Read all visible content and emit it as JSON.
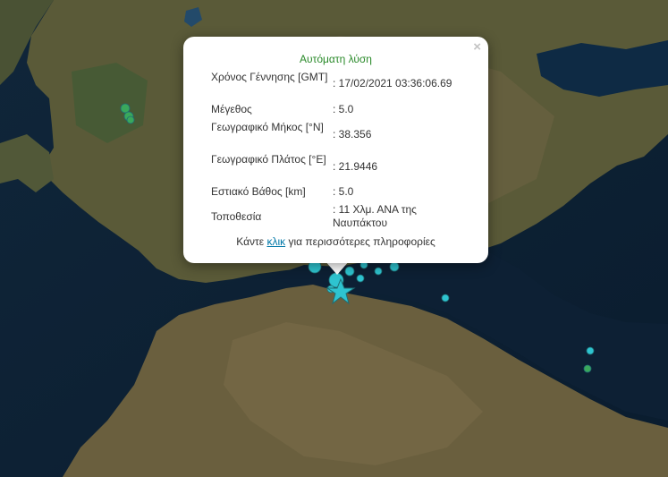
{
  "popup": {
    "title": "Αυτόματη λύση",
    "close_label": "×",
    "rows": [
      {
        "label": "Χρόνος Γέννησης [GMT]",
        "value": ": 17/02/2021 03:36:06.69"
      },
      {
        "label": "Μέγεθος",
        "value": ": 5.0"
      },
      {
        "label": "Γεωγραφικό Μήκος [°N]",
        "value": ": 38.356"
      },
      {
        "label": "Γεωγραφικό Πλάτος [°E]",
        "value": ": 21.9446"
      },
      {
        "label": "Εστιακό Βάθος [km]",
        "value": ": 5.0"
      },
      {
        "label": "Τοποθεσία",
        "value": ": 11 Χλμ. ΑΝΑ της Ναυπάκτου"
      }
    ],
    "more_prefix": "Κάντε",
    "more_link": "κλικ",
    "more_suffix": "για περισσότερες πληροφορίες"
  },
  "map": {
    "colors": {
      "sea": "#0d2236",
      "land": "#5f5e3c",
      "land_dark": "#3f4a2c",
      "mountain": "#7a6a4a",
      "marker_recent": "#2ec4d0",
      "marker_older": "#3aa85c",
      "marker_stroke": "#1f6e74",
      "epicenter": "#2ec4d0"
    },
    "marker_icon": "earthquake-epicenter-star-icon"
  }
}
